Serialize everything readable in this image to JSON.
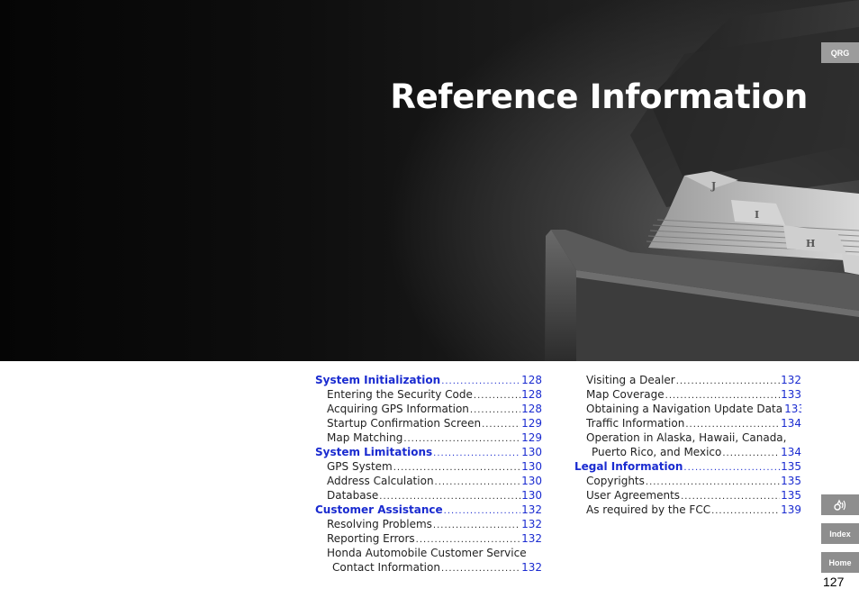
{
  "title": "Reference Information",
  "nav": {
    "qrg": "QRG",
    "voice_icon": "voice-command-icon",
    "index": "Index",
    "home": "Home"
  },
  "page_number": "127",
  "toc": {
    "left": [
      {
        "label": "System Initialization",
        "page": "128",
        "level": "heading"
      },
      {
        "label": "Entering the Security Code",
        "page": "128",
        "level": "sub"
      },
      {
        "label": "Acquiring GPS Information",
        "page": "128",
        "level": "sub"
      },
      {
        "label": "Startup Confirmation Screen",
        "page": "129",
        "level": "sub"
      },
      {
        "label": "Map Matching",
        "page": "129",
        "level": "sub"
      },
      {
        "label": "System Limitations",
        "page": "130",
        "level": "heading"
      },
      {
        "label": "GPS System",
        "page": "130",
        "level": "sub"
      },
      {
        "label": "Address Calculation",
        "page": "130",
        "level": "sub"
      },
      {
        "label": "Database",
        "page": "130",
        "level": "sub"
      },
      {
        "label": "Customer Assistance",
        "page": "132",
        "level": "heading"
      },
      {
        "label": "Resolving Problems",
        "page": "132",
        "level": "sub"
      },
      {
        "label": "Reporting Errors",
        "page": "132",
        "level": "sub"
      },
      {
        "label": "Honda Automobile Customer Service",
        "page": "",
        "level": "sub"
      },
      {
        "label": "Contact Information",
        "page": "132",
        "level": "cont"
      }
    ],
    "right": [
      {
        "label": "Visiting a Dealer",
        "page": "132",
        "level": "sub"
      },
      {
        "label": "Map Coverage",
        "page": "133",
        "level": "sub"
      },
      {
        "label": "Obtaining a Navigation Update Data",
        "page": "133",
        "level": "sub"
      },
      {
        "label": "Traffic Information",
        "page": "134",
        "level": "sub"
      },
      {
        "label": "Operation in Alaska, Hawaii, Canada,",
        "page": "",
        "level": "sub"
      },
      {
        "label": "Puerto Rico, and Mexico",
        "page": "134",
        "level": "cont"
      },
      {
        "label": "Legal Information",
        "page": "135",
        "level": "heading"
      },
      {
        "label": "Copyrights",
        "page": "135",
        "level": "sub"
      },
      {
        "label": "User Agreements",
        "page": "135",
        "level": "sub"
      },
      {
        "label": "As required by the FCC",
        "page": "139",
        "level": "sub"
      }
    ]
  }
}
